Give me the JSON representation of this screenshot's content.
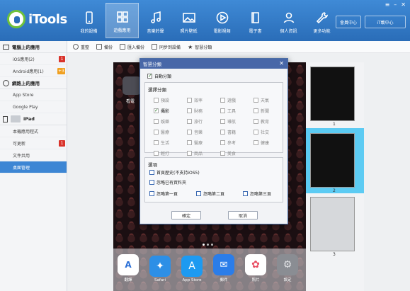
{
  "app": {
    "name": "iTools"
  },
  "nav": [
    {
      "label": "我的設備",
      "icon": "phone-icon"
    },
    {
      "label": "遊戲應用",
      "icon": "apps-grid-icon"
    },
    {
      "label": "音樂鈴聲",
      "icon": "music-note-icon"
    },
    {
      "label": "照片壁紙",
      "icon": "picture-icon"
    },
    {
      "label": "電影視頻",
      "icon": "play-icon"
    },
    {
      "label": "電子書",
      "icon": "book-icon"
    },
    {
      "label": "個人資訊",
      "icon": "user-icon"
    },
    {
      "label": "更多功能",
      "icon": "wrench-icon"
    }
  ],
  "top_buttons": {
    "member": "會員中心",
    "download": "iT載中心"
  },
  "sidebar": {
    "computer_header": "電腦上的應用",
    "computer_items": [
      {
        "label": "iOS應用(2)",
        "badge": "1",
        "badge_color": "#d9332b"
      },
      {
        "label": "Android應用(1)",
        "badge": "+3",
        "badge_color": "#f0a020"
      }
    ],
    "web_header": "網路上的應用",
    "web_items": [
      {
        "label": "App Store"
      },
      {
        "label": "Google Play"
      }
    ],
    "device_header": "iPad",
    "device_items": [
      {
        "label": "本機應用程式"
      },
      {
        "label": "可更新",
        "badge": "1",
        "badge_color": "#d9332b"
      },
      {
        "label": "文件共用"
      },
      {
        "label": "桌面管理",
        "selected": true
      }
    ]
  },
  "toolbar": {
    "items": [
      {
        "label": "重整",
        "icon": "refresh-icon"
      },
      {
        "label": "備份",
        "icon": "backup-icon"
      },
      {
        "label": "匯入備份",
        "icon": "import-icon"
      },
      {
        "label": "同步到設備",
        "icon": "sync-icon"
      },
      {
        "label": "智慧分類",
        "icon": "star-icon"
      }
    ]
  },
  "phone": {
    "folder_label": "看電",
    "dock": [
      {
        "label": "翻譯",
        "color": "#ffffff",
        "icon": "translate-icon"
      },
      {
        "label": "Safari",
        "color": "#2d8fe6",
        "icon": "compass-icon"
      },
      {
        "label": "App Store",
        "color": "#1d9af1",
        "icon": "appstore-icon"
      },
      {
        "label": "郵件",
        "color": "#2b7de9",
        "icon": "mail-icon"
      },
      {
        "label": "照片",
        "color": "#ffffff",
        "icon": "photos-icon"
      },
      {
        "label": "設定",
        "color": "#8a8d93",
        "icon": "gear-icon"
      }
    ]
  },
  "thumbnails": [
    {
      "num": "1"
    },
    {
      "num": "2",
      "selected": true
    },
    {
      "num": "3"
    }
  ],
  "dialog": {
    "title": "智慧分類",
    "auto_classify": {
      "label": "自動分類",
      "checked": true
    },
    "category_title": "選擇分類",
    "categories": [
      [
        "預設",
        "效率",
        "遊戲",
        "天氣"
      ],
      [
        "攝影",
        "財務",
        "工具",
        "新聞"
      ],
      [
        "娛樂",
        "旅行",
        "導航",
        "教育"
      ],
      [
        "醫療",
        "音樂",
        "書籍",
        "社交"
      ],
      [
        "生活",
        "醫療",
        "參考",
        "健康"
      ],
      [
        "輕打",
        "商品",
        "美食",
        ""
      ]
    ],
    "checked_category": "攝影",
    "options_title": "選項",
    "options": [
      {
        "label": "首頁歷史(不支持iOS5)",
        "checked": false
      },
      {
        "label": "忽略已有資料夾",
        "checked": false
      }
    ],
    "ignore": [
      "忽略第一頁",
      "忽略第二頁",
      "忽略第三頁"
    ],
    "ok": "確定",
    "cancel": "取消"
  }
}
